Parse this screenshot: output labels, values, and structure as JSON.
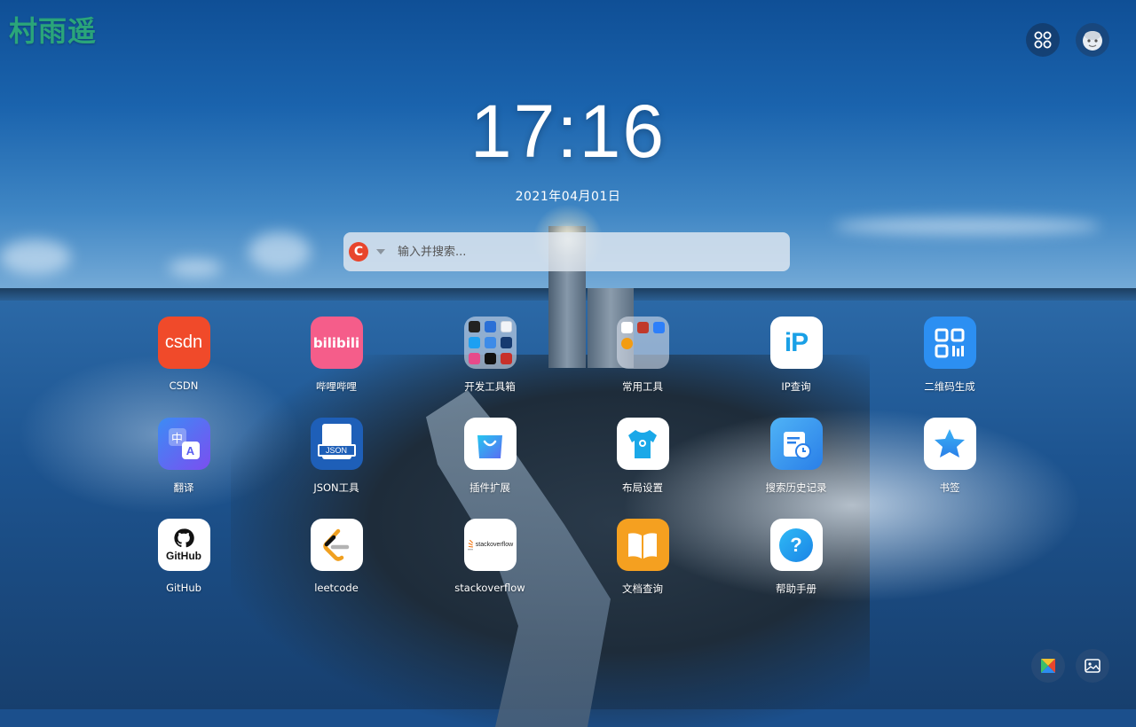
{
  "brand": {
    "title": "村雨遥"
  },
  "clock": {
    "time": "17:16",
    "date": "2021年04月01日"
  },
  "search": {
    "engine_letter": "C",
    "placeholder": "输入并搜索..."
  },
  "apps": [
    {
      "label": "CSDN",
      "icon": "csdn-logo",
      "tile_text": "csdn"
    },
    {
      "label": "哔哩哔哩",
      "icon": "bilibili-logo",
      "tile_text": "bilibili"
    },
    {
      "label": "开发工具箱",
      "icon": "folder-icon"
    },
    {
      "label": "常用工具",
      "icon": "folder-icon"
    },
    {
      "label": "IP查询",
      "icon": "ip-icon",
      "tile_text": "iP"
    },
    {
      "label": "二维码生成",
      "icon": "qrcode-icon"
    },
    {
      "label": "翻译",
      "icon": "translate-icon",
      "tile_text": "中"
    },
    {
      "label": "JSON工具",
      "icon": "json-icon",
      "tile_text": "JSON"
    },
    {
      "label": "插件扩展",
      "icon": "shopping-bag-icon"
    },
    {
      "label": "布局设置",
      "icon": "tshirt-icon"
    },
    {
      "label": "搜索历史记录",
      "icon": "history-icon"
    },
    {
      "label": "书签",
      "icon": "star-icon"
    },
    {
      "label": "GitHub",
      "icon": "github-logo",
      "tile_text": "GitHub"
    },
    {
      "label": "leetcode",
      "icon": "leetcode-logo"
    },
    {
      "label": "stackoverflow",
      "icon": "stackoverflow-logo",
      "tile_text": "stackoverflow"
    },
    {
      "label": "文档查询",
      "icon": "book-icon"
    },
    {
      "label": "帮助手册",
      "icon": "help-icon",
      "tile_text": "?"
    }
  ],
  "colors": {
    "brand": "#2aa57a",
    "search_engine": "#e8452c",
    "csdn": "#f04a2a",
    "bilibili": "#f55d8a",
    "qr": "#2c8ff2",
    "doc": "#f5a020"
  }
}
